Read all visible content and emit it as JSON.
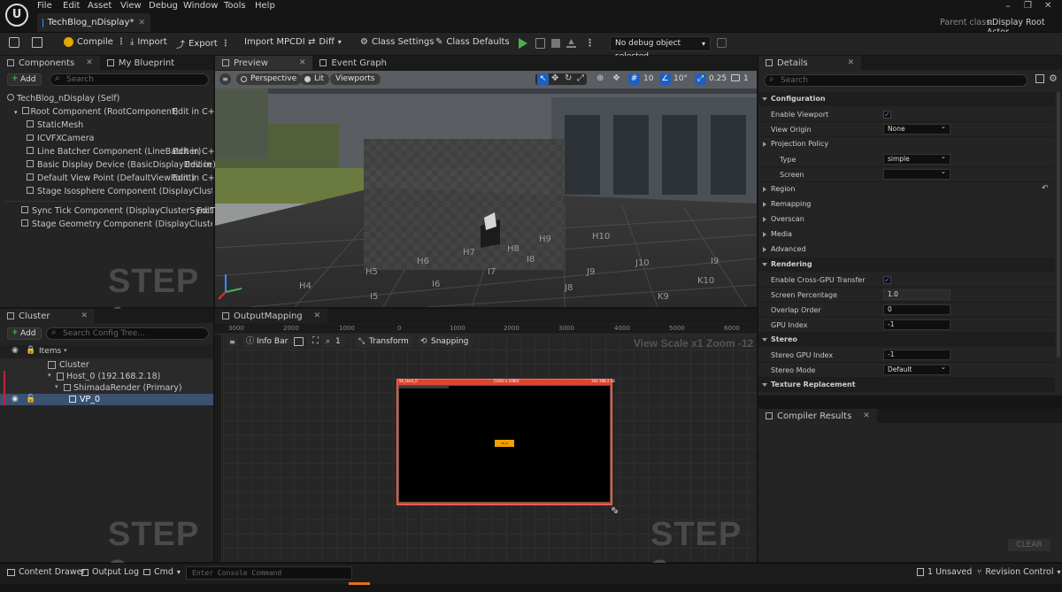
{
  "app": {
    "menu": [
      "File",
      "Edit",
      "Asset",
      "View",
      "Debug",
      "Window",
      "Tools",
      "Help"
    ],
    "doc_tab": "TechBlog_nDisplay*",
    "parent_class_label": "Parent class:",
    "parent_class_value": "nDisplay Root Actor"
  },
  "toolbar": {
    "compile": "Compile",
    "import": "Import",
    "export": "Export",
    "import_mpcdi": "Import MPCDI",
    "diff": "Diff",
    "class_settings": "Class Settings",
    "class_defaults": "Class Defaults",
    "debug_select": "No debug object selected"
  },
  "components_panel": {
    "tab_components": "Components",
    "tab_blueprint": "My Blueprint",
    "add": "Add",
    "search_placeholder": "Search",
    "items": [
      {
        "label": "TechBlog_nDisplay (Self)",
        "edit": ""
      },
      {
        "label": "Root Component (RootComponent)",
        "edit": "Edit in C++"
      },
      {
        "label": "StaticMesh",
        "edit": ""
      },
      {
        "label": "ICVFXCamera",
        "edit": ""
      },
      {
        "label": "Line Batcher Component (LineBatcher)",
        "edit": "Edit in C++"
      },
      {
        "label": "Basic Display Device (BasicDisplayDevice)",
        "edit": "Edit in C"
      },
      {
        "label": "Default View Point (DefaultViewPoint)",
        "edit": "Edit in C++"
      },
      {
        "label": "Stage Isosphere Component (DisplayClusterStageIs",
        "edit": ""
      },
      {
        "label": "Sync Tick Component (DisplayClusterSyncTick)",
        "edit": "Edit"
      },
      {
        "label": "Stage Geometry Component (DisplayClusterStageGeo",
        "edit": ""
      }
    ],
    "step": "STEP 1"
  },
  "viewport": {
    "tab_preview": "Preview",
    "tab_event_graph": "Event Graph",
    "perspective": "Perspective",
    "lit": "Lit",
    "viewports": "Viewports",
    "grid_snap": "10",
    "rot_snap": "10°",
    "scale_snap": "0.25",
    "cam_speed": "1",
    "grid_labels": [
      "H5",
      "H6",
      "H7",
      "H8",
      "H9",
      "H10",
      "H4",
      "I5",
      "I6",
      "I7",
      "I8",
      "J8",
      "J9",
      "J10",
      "K10",
      "K9",
      "I9"
    ]
  },
  "cluster_panel": {
    "tab": "Cluster",
    "add": "Add",
    "search_placeholder": "Search Config Tree...",
    "items_header": "Items",
    "tree": [
      {
        "label": "Cluster"
      },
      {
        "label": "Host_0 (192.168.2.18)"
      },
      {
        "label": "ShimadaRender (Primary)"
      },
      {
        "label": "VP_0"
      }
    ],
    "step": "STEP 2"
  },
  "output_mapping": {
    "tab": "OutputMapping",
    "info_bar": "Info Bar",
    "zoom_count": "1",
    "transform": "Transform",
    "snapping": "Snapping",
    "view_scale": "View Scale x1",
    "zoom": "Zoom -12",
    "ruler_ticks": [
      "3000",
      "2000",
      "1000",
      "0",
      "1000",
      "2000",
      "3000",
      "4000",
      "5000",
      "6000"
    ],
    "step": "STEP 3",
    "canvas_title_left": "Sh_Host_0",
    "canvas_title_mid": "[1920 x 1080]",
    "canvas_title_right": "192.168.2.18",
    "viewport_label": "VP_0"
  },
  "details": {
    "tab": "Details",
    "search_placeholder": "Search",
    "sections": {
      "configuration": "Configuration",
      "region": "Region",
      "remapping": "Remapping",
      "overscan": "Overscan",
      "media": "Media",
      "advanced": "Advanced",
      "rendering": "Rendering",
      "stereo": "Stereo",
      "texture_replacement": "Texture Replacement"
    },
    "props": {
      "enable_viewport": "Enable Viewport",
      "view_origin": "View Origin",
      "view_origin_val": "None",
      "projection_policy": "Projection Policy",
      "type": "Type",
      "type_val": "simple",
      "screen": "Screen",
      "screen_val": "",
      "enable_cross_gpu": "Enable Cross-GPU Transfer",
      "screen_percentage": "Screen Percentage",
      "screen_percentage_val": "1.0",
      "overlap_order": "Overlap Order",
      "overlap_order_val": "0",
      "gpu_index": "GPU Index",
      "gpu_index_val": "-1",
      "stereo_gpu_index": "Stereo GPU Index",
      "stereo_gpu_index_val": "-1",
      "stereo_mode": "Stereo Mode",
      "stereo_mode_val": "Default"
    }
  },
  "compiler": {
    "tab": "Compiler Results",
    "clear": "CLEAR"
  },
  "statusbar": {
    "content_drawer": "Content Drawer",
    "output_log": "Output Log",
    "cmd": "Cmd",
    "console_placeholder": "Enter Console Command",
    "unsaved": "1 Unsaved",
    "revision": "Revision Control"
  },
  "colors": {
    "accent_blue": "#3d8bff",
    "play_green": "#4caf50",
    "canvas_red": "#e0432e",
    "selection_red": "#c8203a",
    "viewport_orange": "#f0a000"
  }
}
